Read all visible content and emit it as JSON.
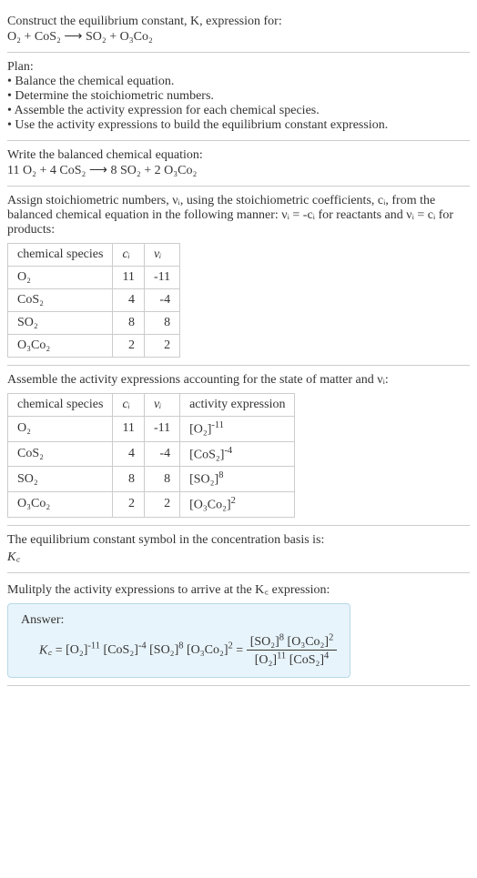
{
  "intro": {
    "line1": "Construct the equilibrium constant, K, expression for:",
    "equation": "O₂ + CoS₂ ⟶ SO₂ + O₃Co₂"
  },
  "plan": {
    "heading": "Plan:",
    "bullets": [
      "Balance the chemical equation.",
      "Determine the stoichiometric numbers.",
      "Assemble the activity expression for each chemical species.",
      "Use the activity expressions to build the equilibrium constant expression."
    ]
  },
  "balanced": {
    "heading": "Write the balanced chemical equation:",
    "equation": "11 O₂ + 4 CoS₂ ⟶ 8 SO₂ + 2 O₃Co₂"
  },
  "stoich": {
    "text_before": "Assign stoichiometric numbers, νᵢ, using the stoichiometric coefficients, cᵢ, from the balanced chemical equation in the following manner: νᵢ = -cᵢ for reactants and νᵢ = cᵢ for products:",
    "headers": [
      "chemical species",
      "cᵢ",
      "νᵢ"
    ],
    "rows": [
      {
        "species": "O₂",
        "c": "11",
        "nu": "-11"
      },
      {
        "species": "CoS₂",
        "c": "4",
        "nu": "-4"
      },
      {
        "species": "SO₂",
        "c": "8",
        "nu": "8"
      },
      {
        "species": "O₃Co₂",
        "c": "2",
        "nu": "2"
      }
    ]
  },
  "activity": {
    "heading": "Assemble the activity expressions accounting for the state of matter and νᵢ:",
    "headers": [
      "chemical species",
      "cᵢ",
      "νᵢ",
      "activity expression"
    ],
    "rows": [
      {
        "species": "O₂",
        "c": "11",
        "nu": "-11",
        "expr_base": "[O₂]",
        "expr_sup": "-11"
      },
      {
        "species": "CoS₂",
        "c": "4",
        "nu": "-4",
        "expr_base": "[CoS₂]",
        "expr_sup": "-4"
      },
      {
        "species": "SO₂",
        "c": "8",
        "nu": "8",
        "expr_base": "[SO₂]",
        "expr_sup": "8"
      },
      {
        "species": "O₃Co₂",
        "c": "2",
        "nu": "2",
        "expr_base": "[O₃Co₂]",
        "expr_sup": "2"
      }
    ]
  },
  "kc_symbol": {
    "line1": "The equilibrium constant symbol in the concentration basis is:",
    "symbol": "K꜀"
  },
  "final": {
    "heading": "Mulitply the activity expressions to arrive at the K꜀ expression:",
    "answer_label": "Answer:",
    "kc": "K꜀",
    "lhs_terms": [
      {
        "base": "[O₂]",
        "sup": "-11"
      },
      {
        "base": "[CoS₂]",
        "sup": "-4"
      },
      {
        "base": "[SO₂]",
        "sup": "8"
      },
      {
        "base": "[O₃Co₂]",
        "sup": "2"
      }
    ],
    "frac_num": [
      {
        "base": "[SO₂]",
        "sup": "8"
      },
      {
        "base": "[O₃Co₂]",
        "sup": "2"
      }
    ],
    "frac_den": [
      {
        "base": "[O₂]",
        "sup": "11"
      },
      {
        "base": "[CoS₂]",
        "sup": "4"
      }
    ]
  },
  "chart_data": {
    "type": "table",
    "tables": [
      {
        "title": "Stoichiometric numbers",
        "headers": [
          "chemical species",
          "c_i",
          "nu_i"
        ],
        "rows": [
          [
            "O2",
            11,
            -11
          ],
          [
            "CoS2",
            4,
            -4
          ],
          [
            "SO2",
            8,
            8
          ],
          [
            "O3Co2",
            2,
            2
          ]
        ]
      },
      {
        "title": "Activity expressions",
        "headers": [
          "chemical species",
          "c_i",
          "nu_i",
          "activity expression"
        ],
        "rows": [
          [
            "O2",
            11,
            -11,
            "[O2]^-11"
          ],
          [
            "CoS2",
            4,
            -4,
            "[CoS2]^-4"
          ],
          [
            "SO2",
            8,
            8,
            "[SO2]^8"
          ],
          [
            "O3Co2",
            2,
            2,
            "[O3Co2]^2"
          ]
        ]
      }
    ]
  }
}
